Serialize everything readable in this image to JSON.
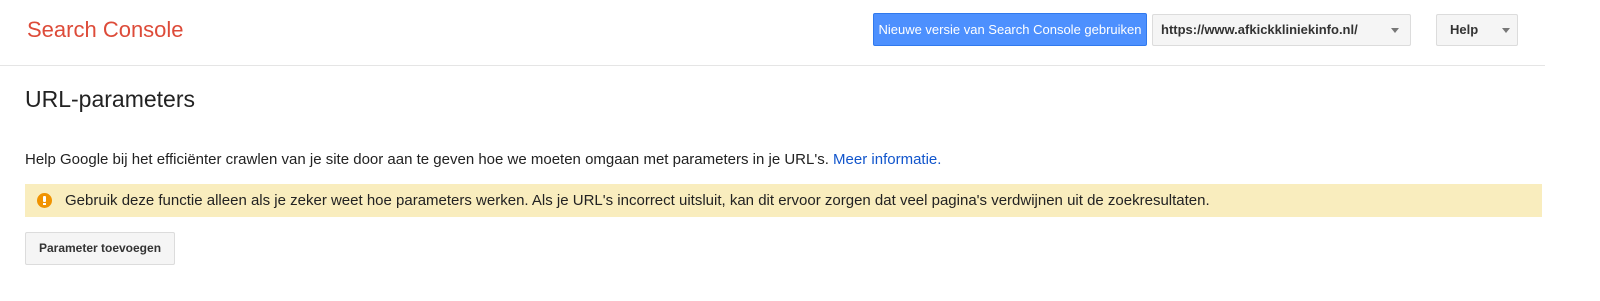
{
  "header": {
    "app_title": "Search Console",
    "new_version_button": "Nieuwe versie van Search Console gebruiken",
    "site_selector": {
      "value": "https://www.afkickkliniekinfo.nl/"
    },
    "help_menu": {
      "label": "Help"
    }
  },
  "main": {
    "title": "URL-parameters",
    "intro_text": "Help Google bij het efficiënter crawlen van je site door aan te geven hoe we moeten omgaan met parameters in je URL's.",
    "intro_link": "Meer informatie.",
    "warning": {
      "icon": "warning-icon",
      "text": "Gebruik deze functie alleen als je zeker weet hoe parameters werken. Als je URL's incorrect uitsluit, kan dit ervoor zorgen dat veel pagina's verdwijnen uit de zoekresultaten."
    },
    "add_parameter_button": "Parameter toevoegen"
  },
  "colors": {
    "brand": "#dd4b39",
    "primary_button": "#4d90fe",
    "link": "#1155cc",
    "warning_background": "#f9edbe",
    "warning_icon": "#f09300"
  }
}
